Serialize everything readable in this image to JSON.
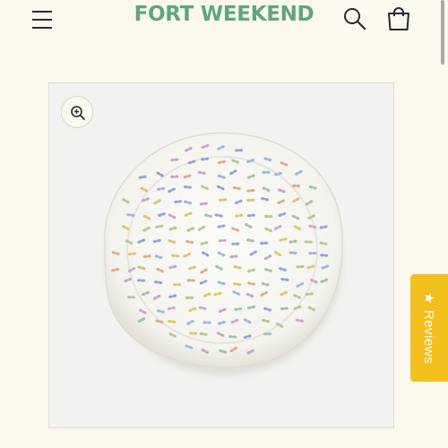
{
  "header": {
    "logo_text": "FORT WEEKEND",
    "menu_icon": "hamburger-menu-icon",
    "search_icon": "search-icon",
    "cart_icon": "shopping-bag-icon"
  },
  "product": {
    "image_subject": "round butterfly-print padded play mat",
    "zoom_icon": "zoom-in-icon"
  },
  "reviews_tab": {
    "star": "★",
    "label": "Reviews"
  },
  "colors": {
    "background": "#fbf8ee",
    "brand_green": "#5fa581",
    "reviews_yellow": "#f3bf1c",
    "icon_dark": "#2a2a2a"
  }
}
